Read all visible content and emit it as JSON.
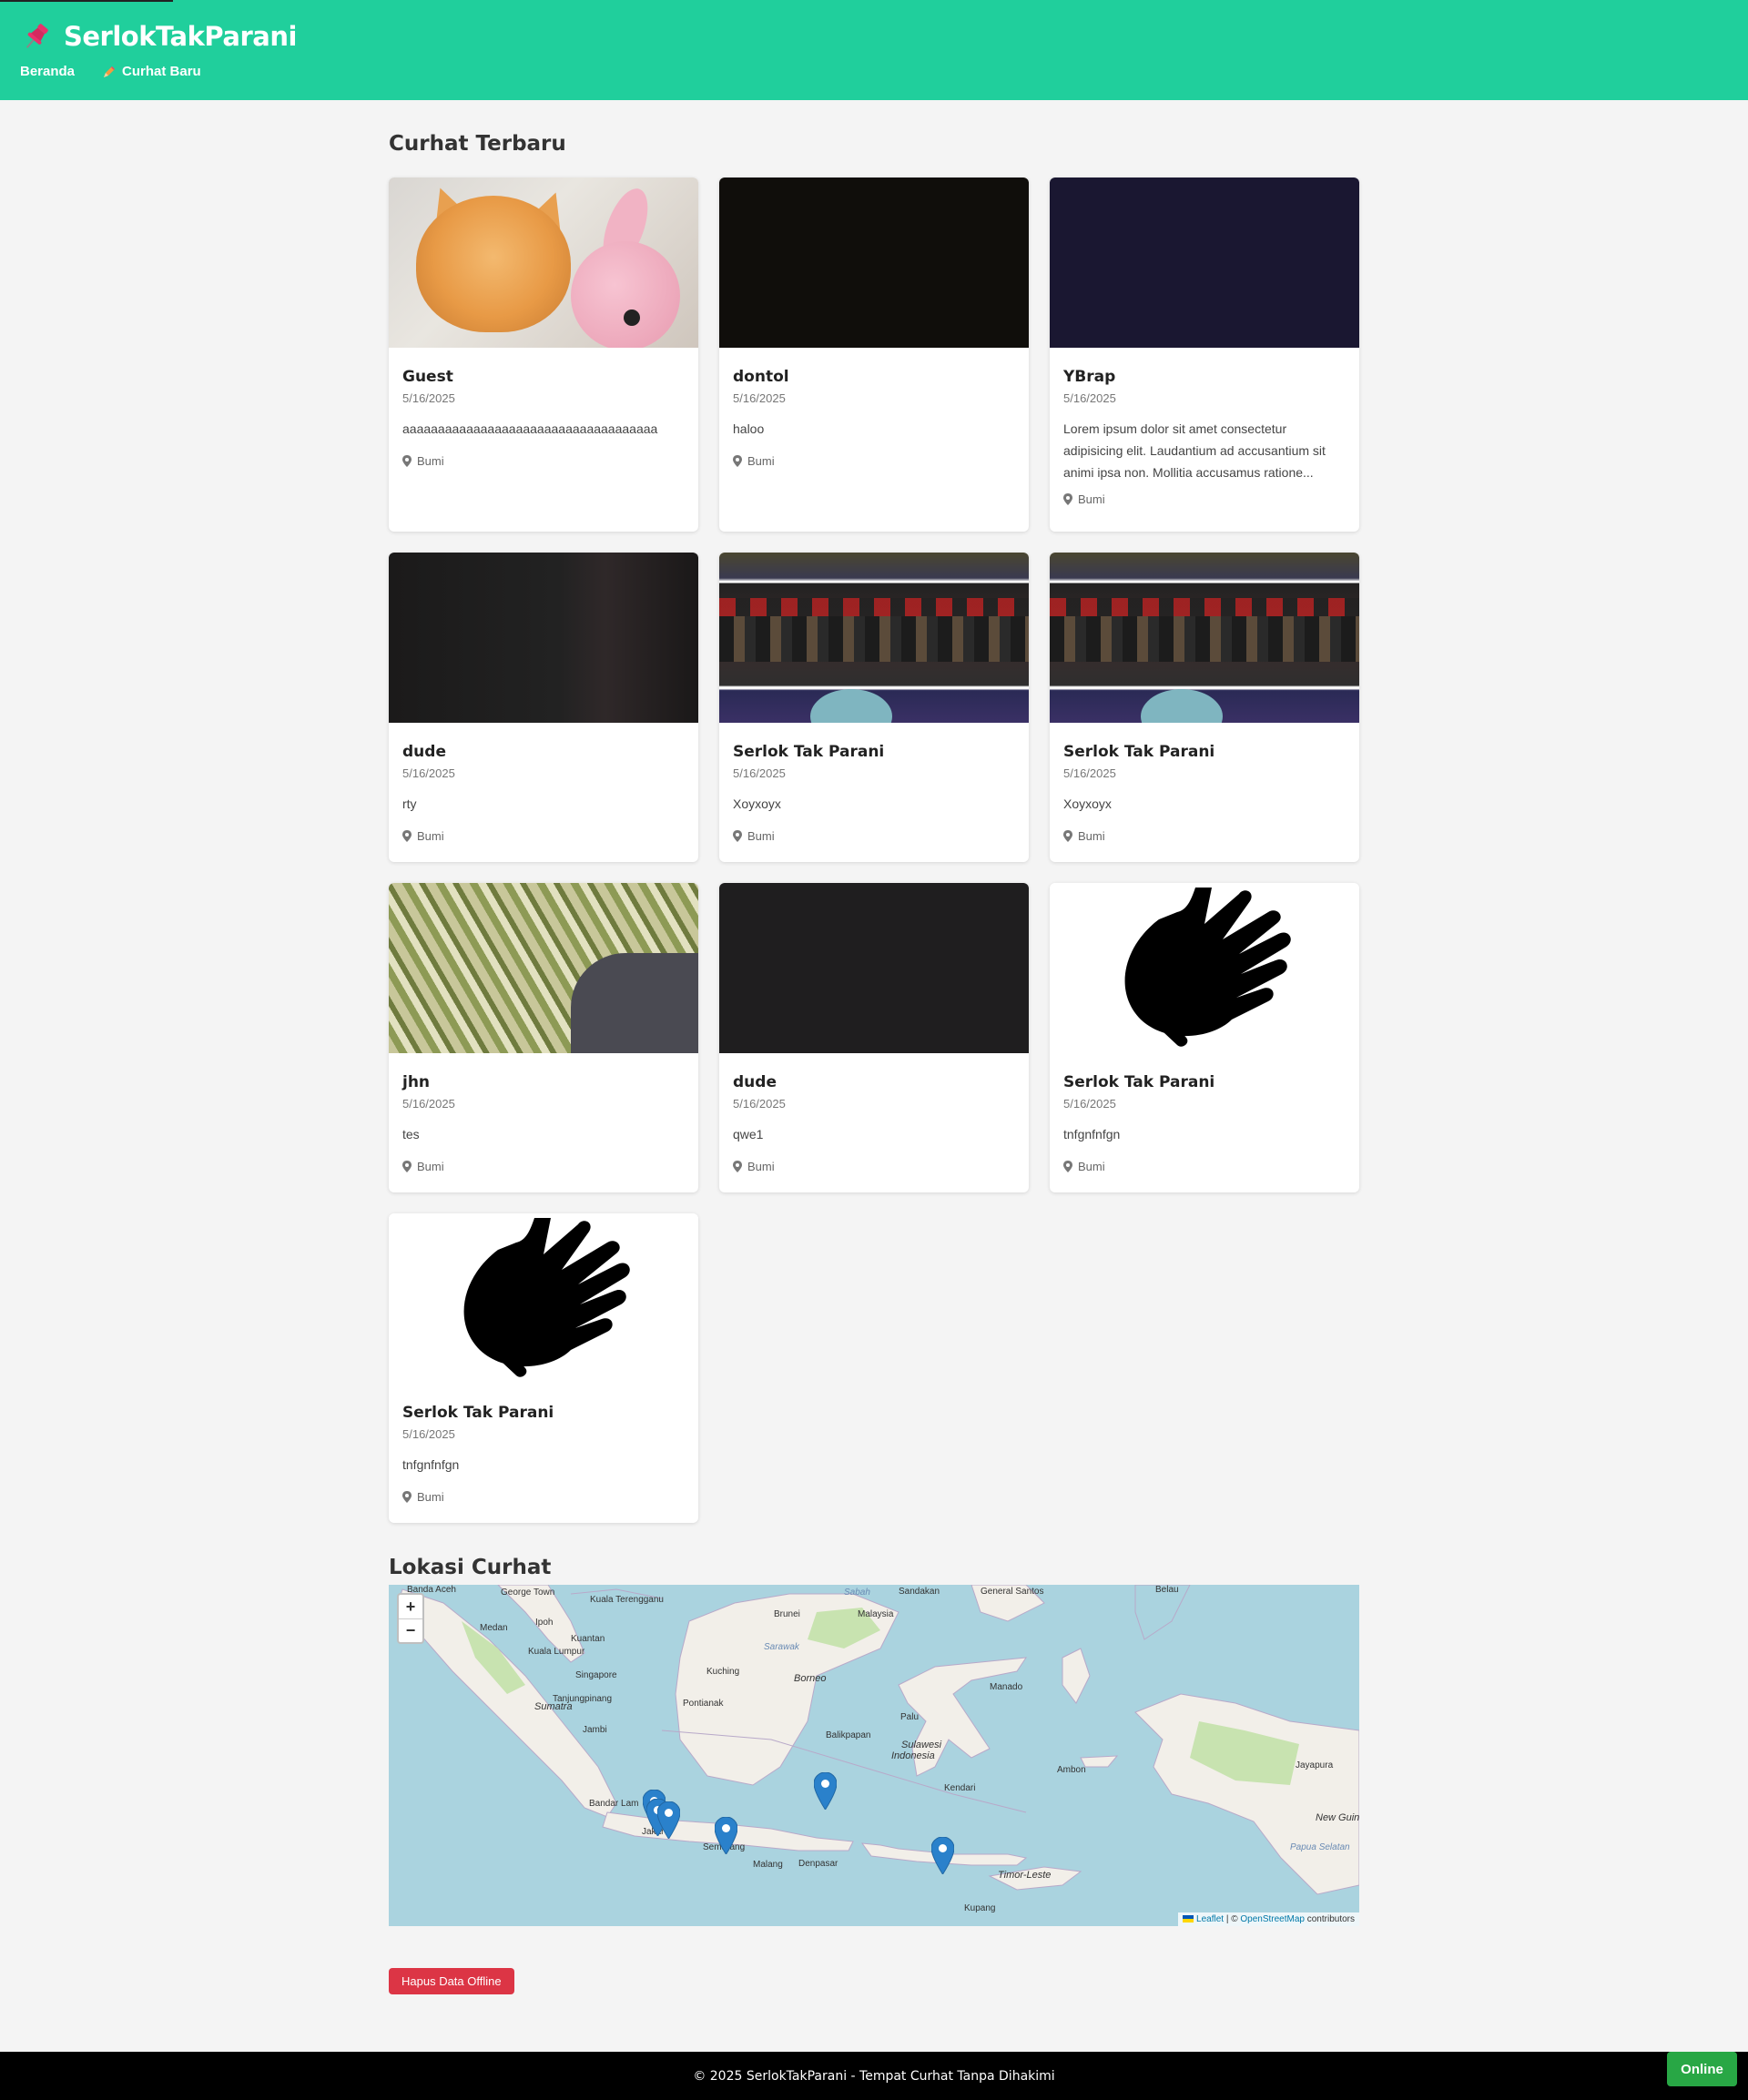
{
  "header": {
    "brand": "SerlokTakParani",
    "nav": [
      {
        "label": "Beranda"
      },
      {
        "label": "Curhat Baru"
      }
    ]
  },
  "main": {
    "title": "Curhat Terbaru",
    "cards": [
      {
        "author": "Guest",
        "date": "5/16/2025",
        "text": "aaaaaaaaaaaaaaaaaaaaaaaaaaaaaaaaaaaa",
        "location": "Bumi",
        "image": "kitten-photo"
      },
      {
        "author": "dontol",
        "date": "5/16/2025",
        "text": "haloo",
        "location": "Bumi",
        "image": "dark-photo"
      },
      {
        "author": "YBrap",
        "date": "5/16/2025",
        "text": "Lorem ipsum dolor sit amet consectetur adipisicing elit. Laudantium ad accusantium sit animi ipsa non. Mollitia accusamus ratione...",
        "location": "Bumi",
        "image": "navy-photo"
      },
      {
        "author": "dude",
        "date": "5/16/2025",
        "text": "rty",
        "location": "Bumi",
        "image": "dark-photo"
      },
      {
        "author": "Serlok Tak Parani",
        "date": "5/16/2025",
        "text": "Xoyxoyx",
        "location": "Bumi",
        "image": "crowd-photo"
      },
      {
        "author": "Serlok Tak Parani",
        "date": "5/16/2025",
        "text": "Xoyxoyx",
        "location": "Bumi",
        "image": "crowd-photo"
      },
      {
        "author": "jhn",
        "date": "5/16/2025",
        "text": "tes",
        "location": "Bumi",
        "image": "sugarcane-photo"
      },
      {
        "author": "dude",
        "date": "5/16/2025",
        "text": "qwe1",
        "location": "Bumi",
        "image": "dark-photo"
      },
      {
        "author": "Serlok Tak Parani",
        "date": "5/16/2025",
        "text": "tnfgnfnfgn",
        "location": "Bumi",
        "image": "hands-icon"
      },
      {
        "author": "Serlok Tak Parani",
        "date": "5/16/2025",
        "text": "tnfgnfnfgn",
        "location": "Bumi",
        "image": "hands-icon"
      }
    ]
  },
  "map": {
    "title": "Lokasi Curhat",
    "zoom_in": "+",
    "zoom_out": "−",
    "labels": {
      "banda_aceh": "Banda Aceh",
      "george_town": "George Town",
      "kuala_terengganu": "Kuala Terengganu",
      "sabah": "Sabah",
      "sandakan": "Sandakan",
      "general_santos": "General Santos",
      "belau": "Belau",
      "ipoh": "Ipoh",
      "brunei": "Brunei",
      "malaysia": "Malaysia",
      "medan": "Medan",
      "kuantan": "Kuantan",
      "kuala_lumpur": "Kuala Lumpur",
      "sarawak": "Sarawak",
      "singapore": "Singapore",
      "kuching": "Kuching",
      "borneo": "Borneo",
      "manado": "Manado",
      "tanjungpinang": "Tanjungpinang",
      "pontianak": "Pontianak",
      "sumatra": "Sumatra",
      "palu": "Palu",
      "jambi": "Jambi",
      "balikpapan": "Balikpapan",
      "sulawesi": "Sulawesi",
      "indonesia": "Indonesia",
      "kendari": "Kendari",
      "ambon": "Ambon",
      "jayapura": "Jayapura",
      "new_guinea": "New Guin",
      "bandar_lampung": "Bandar Lam",
      "jakarta": "Jakar",
      "semarang": "Semarang",
      "malang": "Malang",
      "denpasar": "Denpasar",
      "timor_leste": "Timor-Leste",
      "kupang": "Kupang",
      "papua_selatan": "Papua Selatan"
    },
    "attribution": {
      "leaflet": "Leaflet",
      "sep": "| ©",
      "osm": "OpenStreetMap",
      "contrib": "contributors"
    }
  },
  "actions": {
    "clear_offline": "Hapus Data Offline"
  },
  "footer": {
    "text": "© 2025 SerlokTakParani - Tempat Curhat Tanpa Dihakimi"
  },
  "status": {
    "online": "Online"
  },
  "colors": {
    "header": "#20cf9c",
    "danger": "#dc3545",
    "online": "#28a745",
    "footer": "#000000"
  }
}
